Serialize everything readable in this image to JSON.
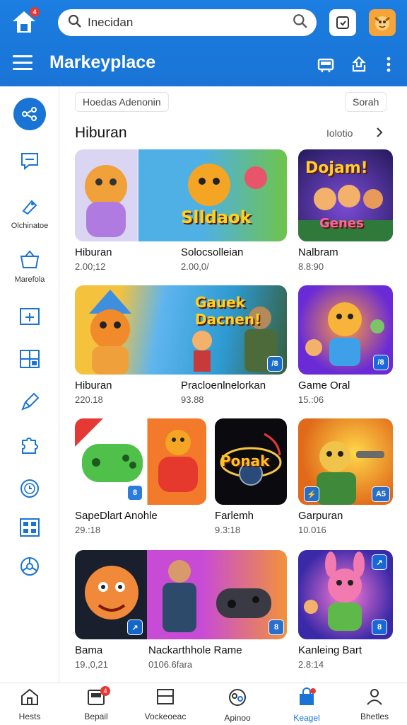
{
  "topbar": {
    "logo_badge": "4",
    "search_text": "Inecidan",
    "title": "Markeyplace"
  },
  "rail": {
    "items": [
      {
        "label": ""
      },
      {
        "label": ""
      },
      {
        "label": "Olchinatoe"
      },
      {
        "label": "Marefola"
      },
      {
        "label": ""
      },
      {
        "label": ""
      },
      {
        "label": ""
      },
      {
        "label": ""
      },
      {
        "label": ""
      },
      {
        "label": ""
      },
      {
        "label": ""
      }
    ]
  },
  "content": {
    "chip_left": "Hoedas Adenonin",
    "chip_right": "Sorah",
    "section_title": "Hiburan",
    "see_all": "Iolotio"
  },
  "cards": [
    {
      "title": "Hiburan",
      "meta": "2.00;12",
      "art_text": "",
      "badge": ""
    },
    {
      "title": "Solocsolleian",
      "meta": "2.00,0/",
      "art_text": "Slldaok",
      "badge": ""
    },
    {
      "title": "Nalbram",
      "meta": "8.8:90",
      "art_text": "Dojam!",
      "art_text2": "Genes",
      "badge": ""
    },
    {
      "title": "Hiburan",
      "meta": "220.18",
      "art_text": "",
      "badge": ""
    },
    {
      "title": "Pracloenlnelorkan",
      "meta": "93.88",
      "art_text": "Gauek Dacnen!",
      "badge": "/8"
    },
    {
      "title": "Game Oral",
      "meta": "15.:06",
      "art_text": "",
      "badge": "/8"
    },
    {
      "title": "SapeDlart Anohle",
      "meta": "29.:18",
      "art_text": "",
      "badge": "8"
    },
    {
      "title": "Farlemh",
      "meta": "9.3:18",
      "art_text": "Ponak",
      "badge": ""
    },
    {
      "title": "Garpuran",
      "meta": "10.016",
      "art_text": "",
      "badge": "A5"
    },
    {
      "title": "Bama",
      "meta": "19.,0,21",
      "art_text": "",
      "badge": ""
    },
    {
      "title": "Nackarthhole Rame",
      "meta": "0106.6fara",
      "art_text": "",
      "badge": "8"
    },
    {
      "title": "Kanleing Bart",
      "meta": "2.8:14",
      "art_text": "",
      "badge": "8"
    }
  ],
  "bottomnav": {
    "items": [
      {
        "label": "Hests"
      },
      {
        "label": "Bepail",
        "badge": "4"
      },
      {
        "label": "Vockeoeac"
      },
      {
        "label": "Apinoo"
      },
      {
        "label": "Keagel"
      },
      {
        "label": "Bhetles"
      }
    ]
  },
  "colors": {
    "brand": "#1a74d6",
    "badge": "#e53935"
  }
}
